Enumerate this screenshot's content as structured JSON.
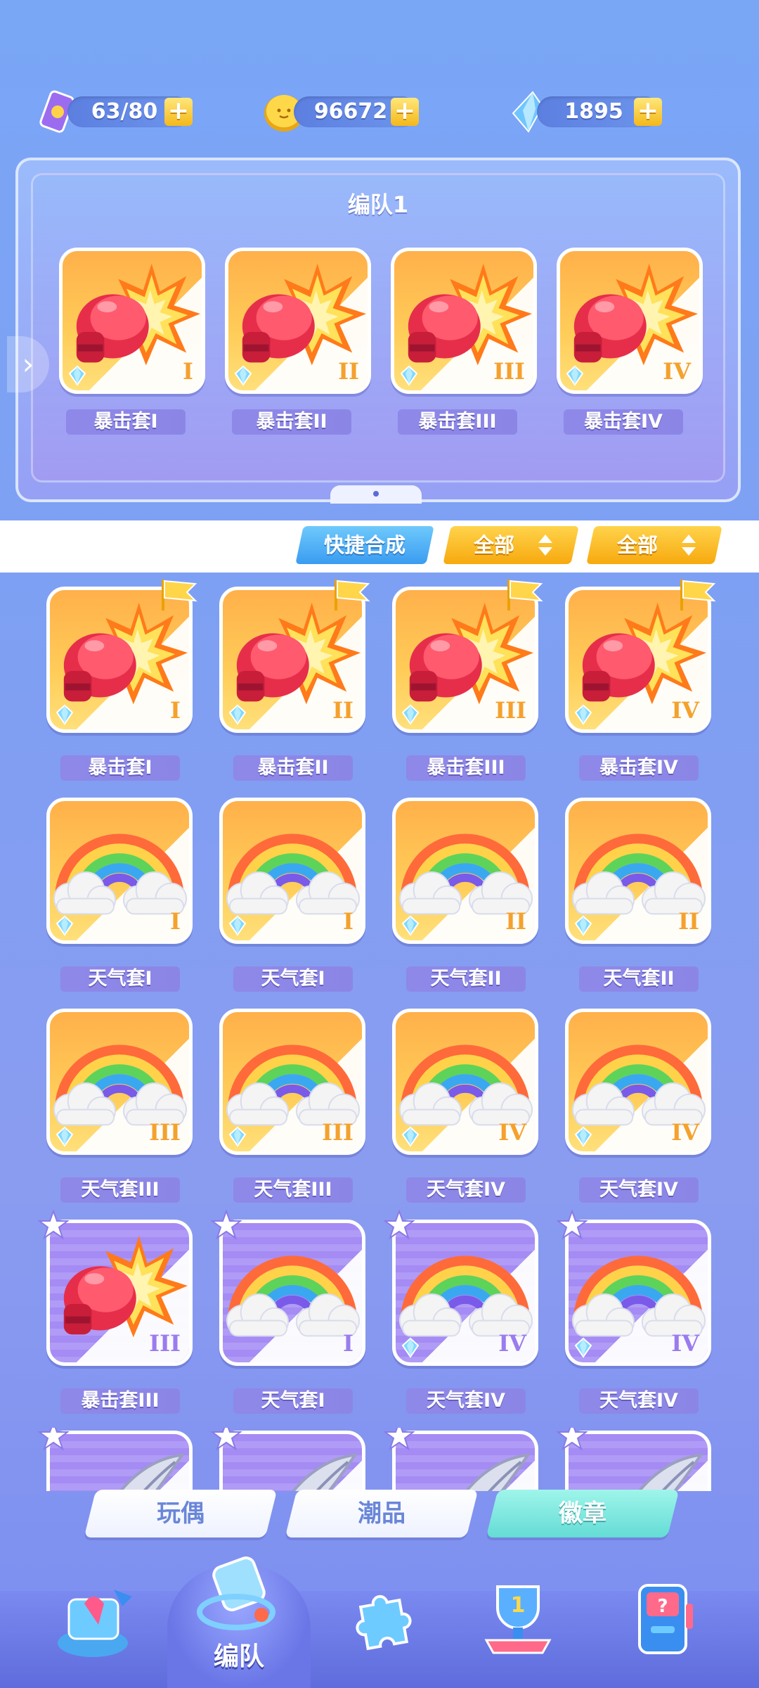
{
  "resources": {
    "stamina": {
      "value": "63/80",
      "icon": "ticket-icon"
    },
    "coins": {
      "value": "96672",
      "icon": "coin-icon"
    },
    "gems": {
      "value": "1895",
      "icon": "crystal-icon"
    },
    "plus_label": "+"
  },
  "team": {
    "title": "编队1",
    "slots": [
      {
        "name": "暴击套I",
        "roman": "I",
        "art": "boxing-glove"
      },
      {
        "name": "暴击套II",
        "roman": "II",
        "art": "boxing-glove"
      },
      {
        "name": "暴击套III",
        "roman": "III",
        "art": "boxing-glove"
      },
      {
        "name": "暴击套IV",
        "roman": "IV",
        "art": "boxing-glove"
      }
    ]
  },
  "filters": {
    "quick_merge": "快捷合成",
    "filter1": "全部",
    "filter2": "全部"
  },
  "badges": {
    "rows": [
      [
        {
          "name": "暴击套I",
          "roman": "I",
          "art": "boxing-glove",
          "color": "orange",
          "marker": "flag"
        },
        {
          "name": "暴击套II",
          "roman": "II",
          "art": "boxing-glove",
          "color": "orange",
          "marker": "flag"
        },
        {
          "name": "暴击套III",
          "roman": "III",
          "art": "boxing-glove",
          "color": "orange",
          "marker": "flag"
        },
        {
          "name": "暴击套IV",
          "roman": "IV",
          "art": "boxing-glove",
          "color": "orange",
          "marker": "flag"
        }
      ],
      [
        {
          "name": "天气套I",
          "roman": "I",
          "art": "rainbow",
          "color": "orange",
          "marker": ""
        },
        {
          "name": "天气套I",
          "roman": "I",
          "art": "rainbow",
          "color": "orange",
          "marker": ""
        },
        {
          "name": "天气套II",
          "roman": "II",
          "art": "rainbow",
          "color": "orange",
          "marker": ""
        },
        {
          "name": "天气套II",
          "roman": "II",
          "art": "rainbow",
          "color": "orange",
          "marker": ""
        }
      ],
      [
        {
          "name": "天气套III",
          "roman": "III",
          "art": "rainbow",
          "color": "orange",
          "marker": ""
        },
        {
          "name": "天气套III",
          "roman": "III",
          "art": "rainbow",
          "color": "orange",
          "marker": ""
        },
        {
          "name": "天气套IV",
          "roman": "IV",
          "art": "rainbow",
          "color": "orange",
          "marker": ""
        },
        {
          "name": "天气套IV",
          "roman": "IV",
          "art": "rainbow",
          "color": "orange",
          "marker": ""
        }
      ],
      [
        {
          "name": "暴击套III",
          "roman": "III",
          "art": "boxing-glove",
          "color": "purple",
          "marker": "star"
        },
        {
          "name": "天气套I",
          "roman": "I",
          "art": "rainbow",
          "color": "purple",
          "marker": "star"
        },
        {
          "name": "天气套IV",
          "roman": "IV",
          "art": "rainbow",
          "color": "purple",
          "marker": "star"
        },
        {
          "name": "天气套IV",
          "roman": "IV",
          "art": "rainbow",
          "color": "purple",
          "marker": "star"
        }
      ]
    ],
    "partial_row": [
      {
        "art": "feather",
        "marker": "star"
      },
      {
        "art": "feather",
        "marker": "star"
      },
      {
        "art": "feather",
        "marker": "star"
      },
      {
        "art": "feather",
        "marker": "star"
      }
    ]
  },
  "category_tabs": [
    {
      "label": "玩偶",
      "active": false
    },
    {
      "label": "潮品",
      "active": false
    },
    {
      "label": "徽章",
      "active": true
    }
  ],
  "nav": {
    "items": [
      "shop-icon",
      "whistle-icon",
      "puzzle-icon",
      "trophy-icon",
      "gacha-machine-icon"
    ],
    "active_label": "编队"
  },
  "colors": {
    "orange_card": "#ffb04a",
    "purple_card": "#a58bf4",
    "label_bg": "#8e88e8",
    "accent_yellow": "#f7a90f",
    "accent_blue": "#3a9cf1",
    "active_tab": "#64dcd5"
  }
}
